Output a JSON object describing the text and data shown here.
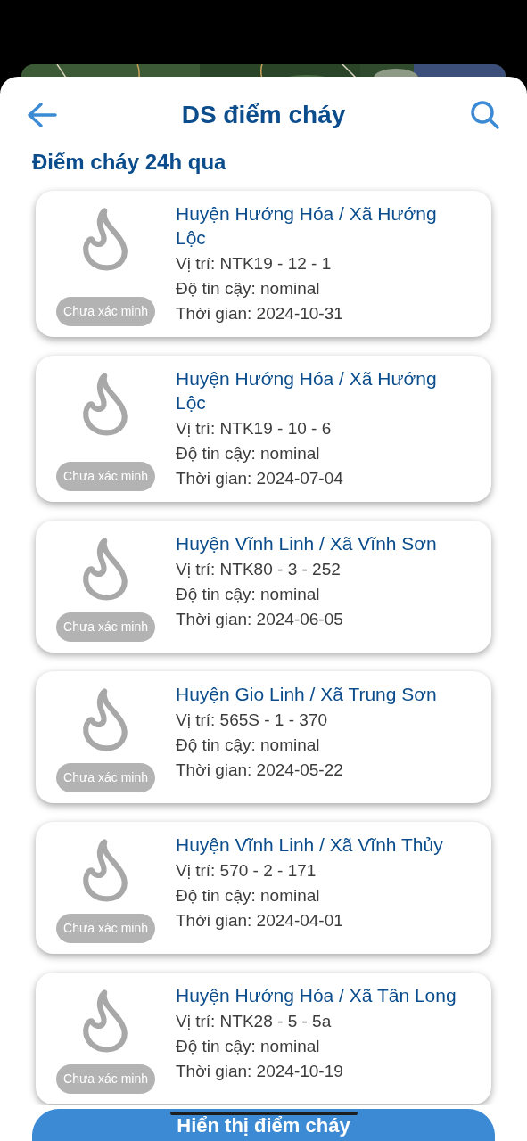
{
  "header": {
    "title": "DS điểm cháy"
  },
  "section_title": "Điểm cháy 24h qua",
  "fires": [
    {
      "place": "Huyện Hướng Hóa / Xã Hướng Lộc",
      "status": "Chưa xác minh",
      "lines": [
        "Vị trí: NTK19 - 12 - 1",
        "Độ tin cậy: nominal",
        "Thời gian: 2024-10-31"
      ]
    },
    {
      "place": "Huyện Hướng Hóa / Xã Hướng Lộc",
      "status": "Chưa xác minh",
      "lines": [
        "Vị trí: NTK19 - 10 - 6",
        "Độ tin cậy: nominal",
        "Thời gian: 2024-07-04"
      ]
    },
    {
      "place": "Huyện Vĩnh Linh / Xã Vĩnh Sơn",
      "status": "Chưa xác minh",
      "lines": [
        "Vị trí: NTK80 - 3 - 252",
        "Độ tin cậy: nominal",
        "Thời gian: 2024-06-05"
      ]
    },
    {
      "place": "Huyện Gio Linh / Xã Trung Sơn",
      "status": "Chưa xác minh",
      "lines": [
        "Vị trí: 565S - 1 - 370",
        "Độ tin cậy: nominal",
        "Thời gian: 2024-05-22"
      ]
    },
    {
      "place": "Huyện Vĩnh Linh / Xã Vĩnh Thủy",
      "status": "Chưa xác minh",
      "lines": [
        "Vị trí: 570 - 2 - 171",
        "Độ tin cậy: nominal",
        "Thời gian: 2024-04-01"
      ]
    },
    {
      "place": "Huyện Hướng Hóa / Xã Tân Long",
      "status": "Chưa xác minh",
      "lines": [
        "Vị trí: NTK28 - 5 - 5a",
        "Độ tin cậy: nominal",
        "Thời gian: 2024-10-19"
      ]
    }
  ],
  "bottom_button": "Hiển thị điểm cháy"
}
